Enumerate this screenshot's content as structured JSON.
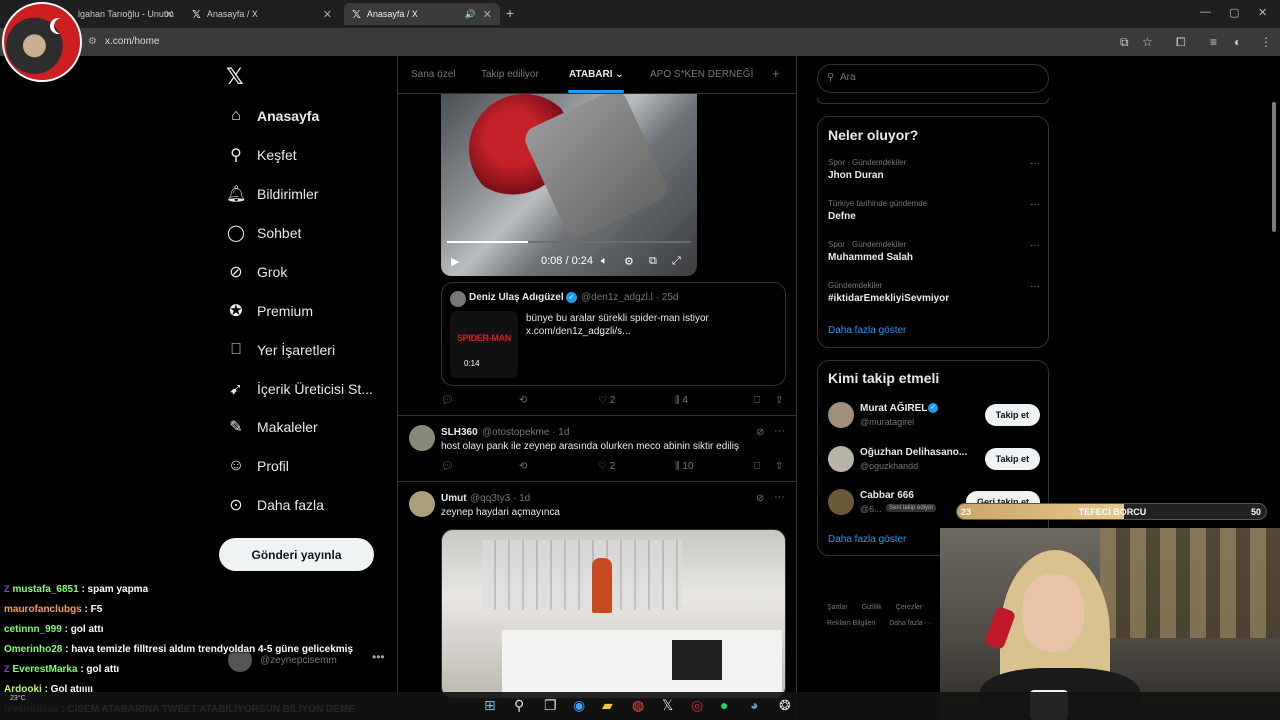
{
  "browser": {
    "tabs": [
      {
        "label": "lgahan Tarıoğlu - Unutm"
      },
      {
        "label": "Anasayfa / X"
      },
      {
        "label": "Anasayfa / X"
      }
    ],
    "new_tab": "+",
    "url": "x.com/home",
    "window_controls": [
      "—",
      "▢",
      "✕"
    ]
  },
  "nav": {
    "logo": "𝕏",
    "items": [
      {
        "label": "Anasayfa",
        "icon": "home-icon"
      },
      {
        "label": "Keşfet",
        "icon": "search-icon"
      },
      {
        "label": "Bildirimler",
        "icon": "bell-icon"
      },
      {
        "label": "Sohbet",
        "icon": "chat-bubble-icon"
      },
      {
        "label": "Grok",
        "icon": "grok-icon"
      },
      {
        "label": "Premium",
        "icon": "verified-icon"
      },
      {
        "label": "Yer İşaretleri",
        "icon": "bookmark-icon"
      },
      {
        "label": "İçerik Üreticisi St...",
        "icon": "rocket-icon"
      },
      {
        "label": "Makaleler",
        "icon": "article-icon"
      },
      {
        "label": "Profil",
        "icon": "person-icon"
      },
      {
        "label": "Daha fazla",
        "icon": "more-circle-icon"
      }
    ],
    "post_button": "Gönderi yayınla",
    "account_handle": "@zeynepcisemm",
    "account_more": "•••"
  },
  "feed": {
    "tabs": [
      {
        "label": "Sana özel"
      },
      {
        "label": "Takip ediliyor"
      },
      {
        "label": "ATABARI"
      },
      {
        "label": "APO S*KEN DERNEĞİ"
      }
    ],
    "add_tab": "+",
    "video": {
      "time": "0:08 / 0:24",
      "progress": 0.33
    },
    "quote": {
      "name": "Deniz Ulaş Adıgüzel",
      "handle": "@den1z_adgzl.l · 25d",
      "text": "bünye bu aralar sürekli spider-man istiyor x.com/den1z_adgzli/s...",
      "thumb_title": "SPIDER-MAN",
      "thumb_duration": "0:14"
    },
    "actions_1": {
      "replies": "",
      "reposts": "",
      "likes": "2",
      "views": "4"
    },
    "posts": [
      {
        "name": "SLH360",
        "handle": "@otostopekme · 1d",
        "text": "host olayı pank ile zeynep arasında olurken meco abinin   siktir ediliş",
        "likes": "2",
        "views": "10"
      },
      {
        "name": "Umut",
        "handle": "@qq3ty3 · 1d",
        "text": "zeynep haydari açmayınca"
      }
    ]
  },
  "sidebar": {
    "search_placeholder": "Ara",
    "trends_title": "Neler oluyor?",
    "trends": [
      {
        "category": "Spor · Gündemdekiler",
        "name": "Jhon Duran"
      },
      {
        "category": "Türkiye tarihinde gündemde",
        "name": "Defne"
      },
      {
        "category": "Spor · Gündemdekiler",
        "name": "Muhammed Salah"
      },
      {
        "category": "Gündemdekiler",
        "name": "#iktidarEmekliyiSevmiyor"
      }
    ],
    "trends_more": "Daha fazla göster",
    "follow_title": "Kimi takip etmeli",
    "follows": [
      {
        "name": "Murat AĞIREL",
        "handle": "@muratagirel",
        "button": "Takip et",
        "verified": true
      },
      {
        "name": "Oğuzhan Delihasano...",
        "handle": "@oguzkhandd",
        "button": "Takip et"
      },
      {
        "name": "Cabbar 666",
        "handle": "@6...",
        "badge": "Seni takip ediyor",
        "button": "Geri takip et"
      }
    ],
    "follow_more": "Daha fazla göster",
    "footer": [
      "Şartlar",
      "Gizlilik",
      "Çerezler",
      "Reklam Bilgileri",
      "Daha fazla ···"
    ]
  },
  "overlay": {
    "debt": {
      "start": "23",
      "label": "TEFECİ BORCU",
      "end": "50",
      "fill": 0.54
    },
    "chat": [
      {
        "user": "mustafa_6851",
        "msg": ": spam yapma",
        "color": "#7dff6b",
        "badge": "Z"
      },
      {
        "user": "maurofanclubgs",
        "msg": ": F5",
        "color": "#ff9b3d"
      },
      {
        "user": "cetinnn_999",
        "msg": ": gol attı",
        "color": "#7dff6b"
      },
      {
        "user": "Omerinho28",
        "msg": ": hava temizle filltresi aldım trendyoldan 4-5 güne gelicekmiş",
        "color": "#7dff6b"
      },
      {
        "user": "EverestMarka",
        "msg": ": gol attı",
        "color": "#7dff6b",
        "badge": "Z"
      },
      {
        "user": "Ardooki",
        "msg": ": Gol atııııı",
        "color": "#b6ff4a"
      },
      {
        "user": "leventulsaa",
        "msg": ": CİSEM ATABARINA TWEET ATABİLİYORSUN BİLİYON DEME",
        "color": "#c27dff"
      }
    ],
    "weather": "23°C"
  },
  "colors": {
    "accent": "#1d9bf0",
    "background": "#000000",
    "border": "#2f3336",
    "muted": "#71767b"
  }
}
